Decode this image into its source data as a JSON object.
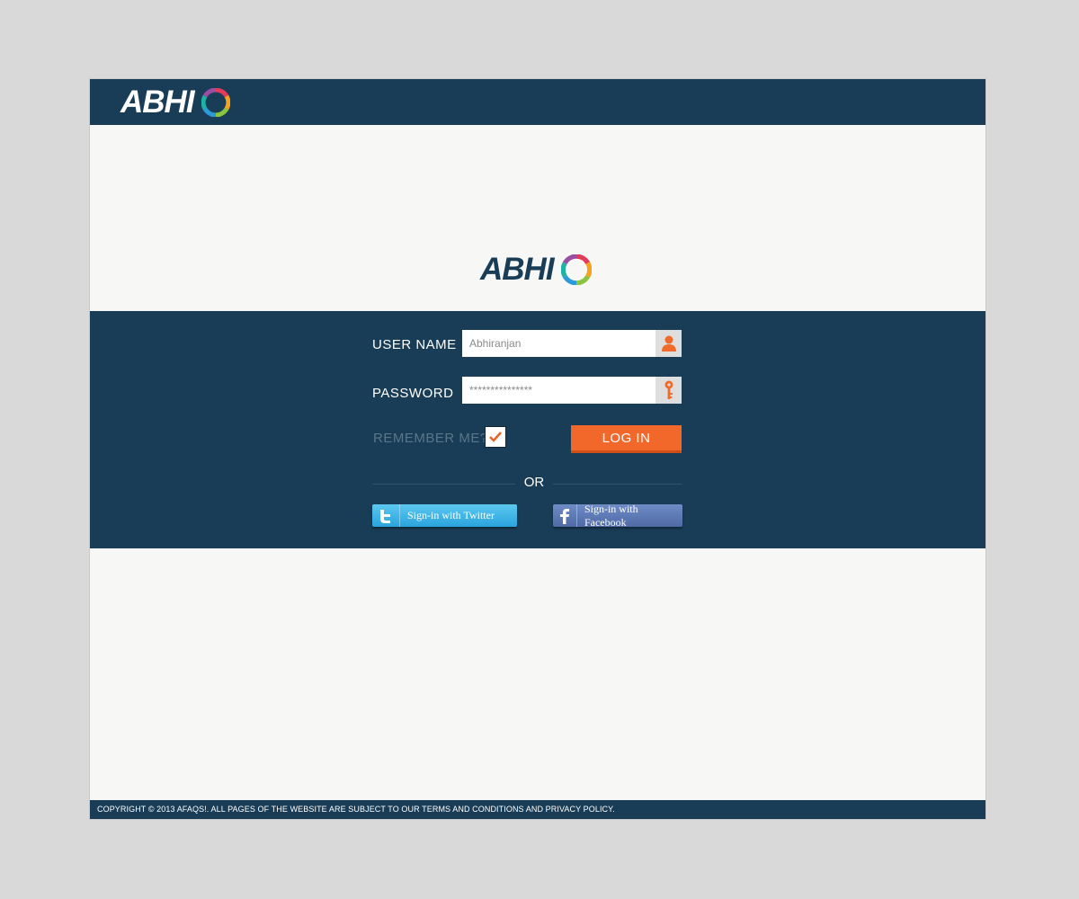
{
  "header": {
    "logo_text": "ABHI"
  },
  "hero": {
    "logo_text": "ABHI"
  },
  "login": {
    "username_label": "USER NAME",
    "username_value": "Abhiranjan",
    "password_label": "PASSWORD",
    "password_value": "***************",
    "remember_label": "REMEMBER ME?",
    "remember_checked": true,
    "login_button_label": "LOG IN",
    "or_label": "OR",
    "twitter_label": "Sign-in with Twitter",
    "facebook_label": "Sign-in with Facebook"
  },
  "icons": {
    "logo": "colorful-ring-icon",
    "username": "user-icon",
    "password": "key-icon",
    "checkbox": "checkmark-icon",
    "twitter": "twitter-bird-icon",
    "facebook": "facebook-f-icon"
  },
  "colors": {
    "navy": "#193d56",
    "accent_orange": "#f2672a",
    "background": "#d9d9d9",
    "twitter_blue": "#2aa4dd",
    "facebook_blue": "#4f6aa6"
  },
  "footer": {
    "text": "COPYRIGHT © 2013 AFAQS!. ALL PAGES OF THE WEBSITE ARE SUBJECT TO OUR TERMS AND CONDITIONS AND PRIVACY POLICY."
  }
}
